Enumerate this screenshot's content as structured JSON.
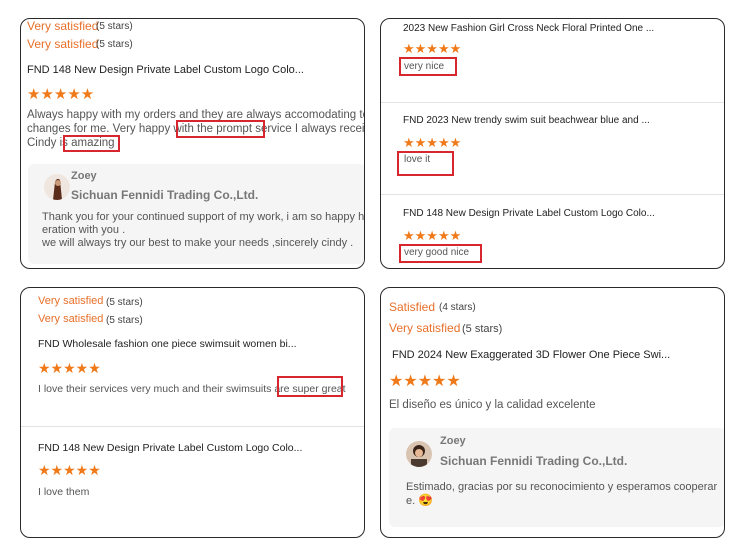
{
  "cards": {
    "tl": {
      "rating1_label": "Very satisfied",
      "rating1_count": "(5 stars)",
      "rating2_label": "Very satisfied",
      "rating2_count": "(5 stars)",
      "product": "FND 148 New Design Private Label Custom Logo Colo...",
      "stars": "★★★★★",
      "review_line1": "Always happy with my orders and they are always accomodating to make",
      "review_line2": "changes for me. Very happy with the prompt service I always receive and",
      "review_line3": "Cindy is amazing",
      "reply": {
        "name": "Zoey",
        "shop": "Sichuan Fennidi Trading Co.,Ltd.",
        "line1": "Thank you for your continued support of my work, i am so happy have c",
        "line2": "eration with you .",
        "line3": "we will always try our best to  make your needs ,sincerely cindy ."
      }
    },
    "tr": {
      "r1_product": "2023 New Fashion Girl Cross Neck Floral Printed One ...",
      "r1_stars": "★★★★★",
      "r1_text": "very nice",
      "r2_product": "FND 2023 New trendy swim suit beachwear blue and ...",
      "r2_stars": "★★★★★",
      "r2_text": "love it",
      "r3_product": "FND 148 New Design Private Label Custom Logo Colo...",
      "r3_stars": "★★★★★",
      "r3_text": "very good nice"
    },
    "bl": {
      "rating1_label": "Very satisfied",
      "rating1_count": "(5 stars)",
      "rating2_label": "Very satisfied",
      "rating2_count": "(5 stars)",
      "r1_product": "FND  Wholesale fashion one piece swimsuit women bi...",
      "r1_stars": "★★★★★",
      "r1_text": "I love their services very much and their swimsuits are super great",
      "r2_product": "FND 148 New Design Private Label Custom Logo Colo...",
      "r2_stars": "★★★★★",
      "r2_text": "I love them"
    },
    "br": {
      "rating1_label": "Satisfied",
      "rating1_count": "(4 stars)",
      "rating2_label": "Very satisfied",
      "rating2_count": "(5 stars)",
      "product": "FND 2024 New Exaggerated 3D Flower One Piece Swi...",
      "stars": "★★★★★",
      "review": "El diseño es único y la calidad excelente",
      "reply": {
        "name": "Zoey",
        "shop": "Sichuan Fennidi Trading Co.,Ltd.",
        "line1": "Estimado, gracias por su reconocimiento y esperamos cooperar",
        "line2": "e.",
        "emoji": "😍"
      }
    }
  }
}
